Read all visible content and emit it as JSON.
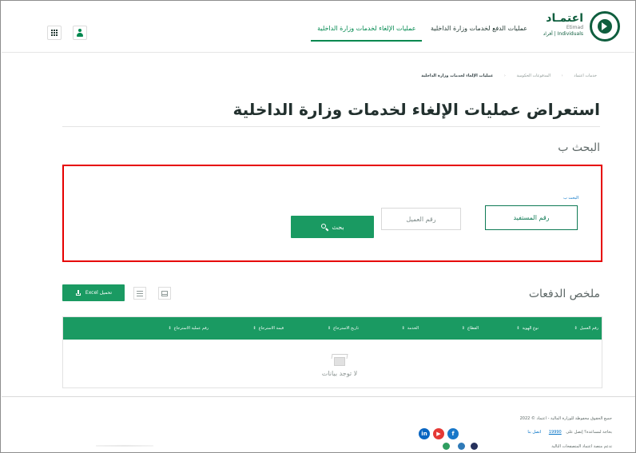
{
  "header": {
    "logo": {
      "name": "اعتمـاد",
      "latin": "Etimad",
      "sub": "Individuals | أفراد"
    },
    "nav": [
      {
        "label": "عمليات الدفع لخدمات وزارة الداخلية",
        "active": false
      },
      {
        "label": "عمليات الإلغاء لخدمات وزارة الداخلية",
        "active": true
      }
    ],
    "icons": [
      "apps-grid-icon",
      "user-icon"
    ]
  },
  "breadcrumb": {
    "items": [
      "خدمات اعتماد",
      "المدفوعات الحكومية"
    ],
    "current": "عمليات الإلغاء لخدمات وزارة الداخلية"
  },
  "page": {
    "title": "استعراض عمليات الإلغاء لخدمات وزارة الداخلية"
  },
  "search": {
    "section_title": "البحث ب",
    "caption": "البحث ب",
    "options": [
      {
        "label": "رقم المستفيد",
        "selected": true
      },
      {
        "label": "رقم العميل",
        "selected": false
      }
    ],
    "button_label": "بحث"
  },
  "summary": {
    "section_title": "ملخص الدفعات",
    "download_label": "تحميل Excel",
    "view_icons": [
      "list-view-icon",
      "table-view-icon"
    ]
  },
  "table": {
    "columns": [
      {
        "label": "رقم العميل",
        "sort": "⇕"
      },
      {
        "label": "نوع الهوية",
        "sort": "⇕"
      },
      {
        "label": "القطاع",
        "sort": "⇕"
      },
      {
        "label": "الخدمة",
        "sort": "⇕"
      },
      {
        "label": "تاريخ الاسترجاع",
        "sort": "⇕"
      },
      {
        "label": "قيمة الاسترجاع",
        "sort": "⇕"
      },
      {
        "label": "رقم عملية الاسترجاع",
        "sort": "⇕"
      }
    ],
    "empty_message": "لا توجد بيانات"
  },
  "footer": {
    "copyright": "جميع الحقوق محفوظة للوزارة المالية - اعتماد © 2022",
    "help": "بحاجة لمساعدة؟ إتصل على",
    "phone": "19990",
    "contact": "اتصل بنا",
    "apps": "تدعم منصة اعتماد المتصفحات التالية",
    "social_icons": [
      "facebook-icon",
      "youtube-icon",
      "linkedin-icon"
    ],
    "browser_icons": [
      "chrome-icon",
      "firefox-icon",
      "edge-icon"
    ]
  },
  "colors": {
    "brand_green": "#1a9a62",
    "active_nav": "#00884f",
    "outline_red": "#e60000",
    "link_blue": "#0071c5"
  }
}
